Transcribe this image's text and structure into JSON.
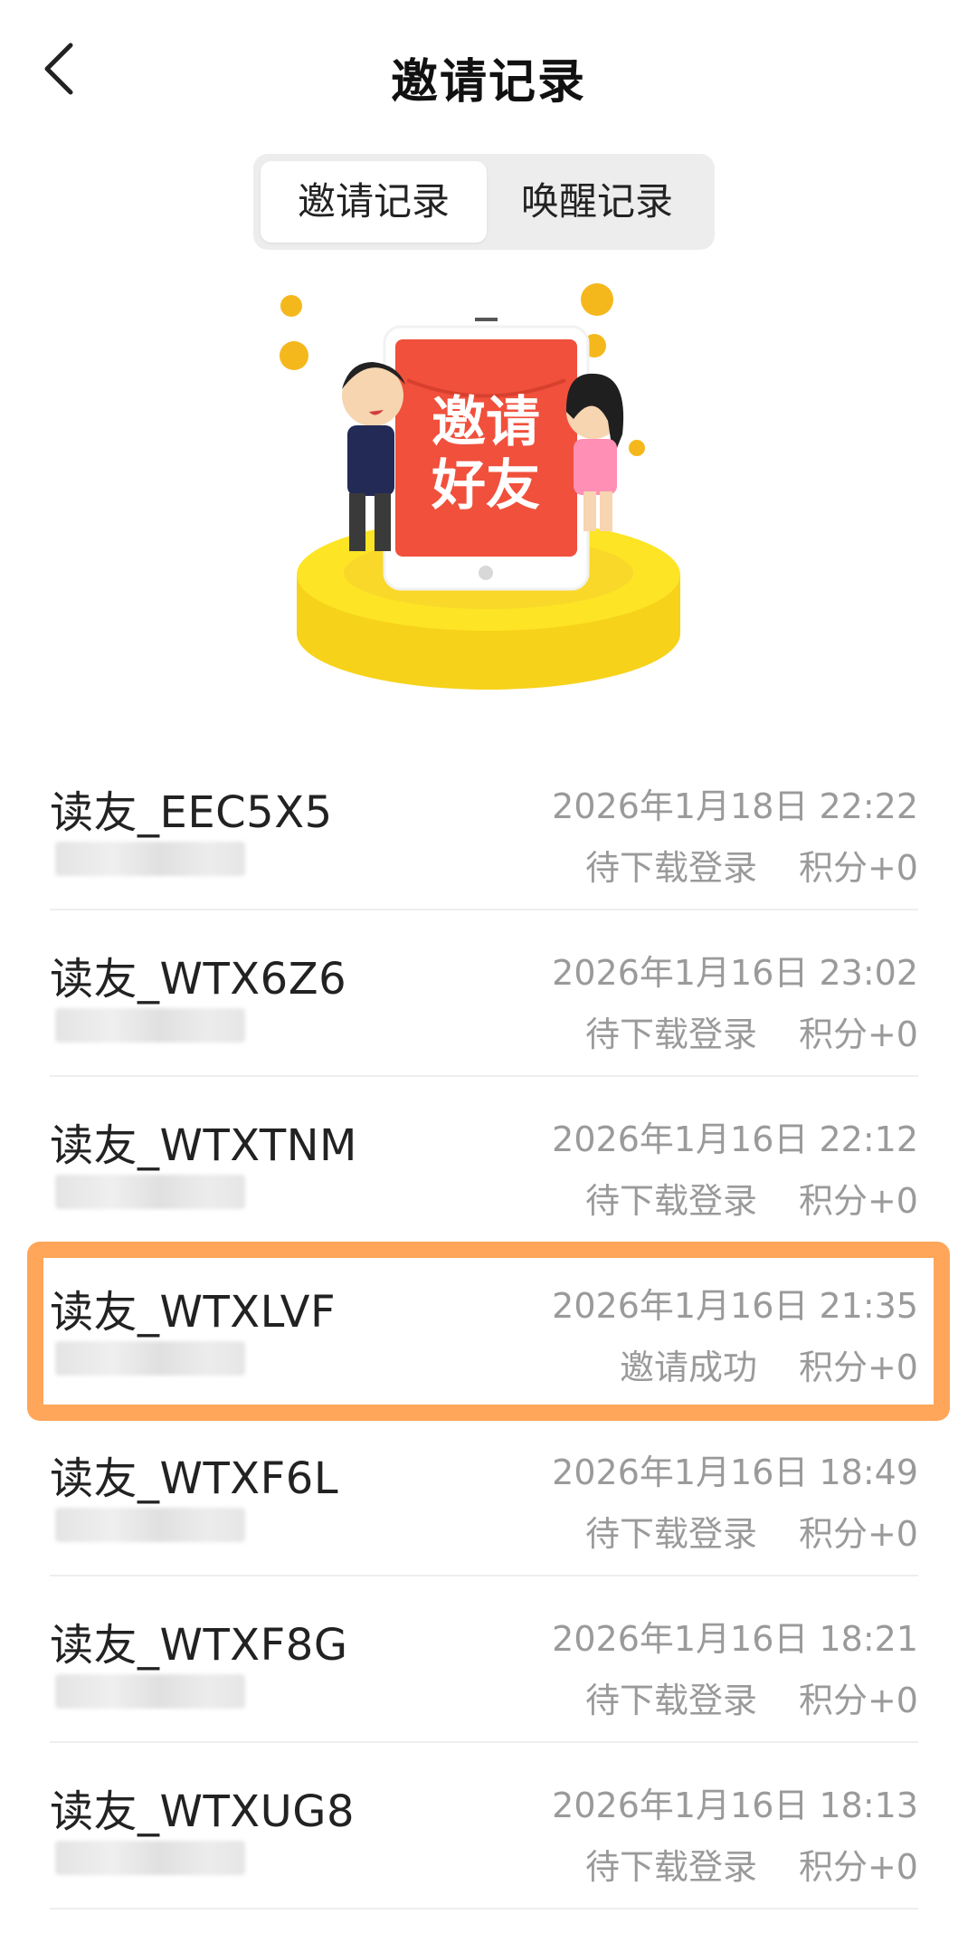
{
  "header": {
    "title": "邀请记录",
    "back_icon": "chevron-left-icon"
  },
  "tabs": [
    {
      "label": "邀请记录",
      "active": true
    },
    {
      "label": "唤醒记录",
      "active": false
    }
  ],
  "hero": {
    "phone_text_line1": "邀请",
    "phone_text_line2": "好友"
  },
  "colors": {
    "highlight": "#ffa65a",
    "secondary_text": "#9a9a9a",
    "phone_red": "#f0503c",
    "coin_gold": "#f5b81c",
    "platform_yellow": "#fde425"
  },
  "records": [
    {
      "name": "读友_EEC5X5",
      "time": "2026年1月18日 22:22",
      "status": "待下载登录",
      "points": "积分+0"
    },
    {
      "name": "读友_WTX6Z6",
      "time": "2026年1月16日 23:02",
      "status": "待下载登录",
      "points": "积分+0"
    },
    {
      "name": "读友_WTXTNM",
      "time": "2026年1月16日 22:12",
      "status": "待下载登录",
      "points": "积分+0"
    },
    {
      "name": "读友_WTXLVF",
      "time": "2026年1月16日 21:35",
      "status": "邀请成功",
      "points": "积分+0",
      "highlighted": true
    },
    {
      "name": "读友_WTXF6L",
      "time": "2026年1月16日 18:49",
      "status": "待下载登录",
      "points": "积分+0"
    },
    {
      "name": "读友_WTXF8G",
      "time": "2026年1月16日 18:21",
      "status": "待下载登录",
      "points": "积分+0"
    },
    {
      "name": "读友_WTXUG8",
      "time": "2026年1月16日 18:13",
      "status": "待下载登录",
      "points": "积分+0"
    }
  ]
}
